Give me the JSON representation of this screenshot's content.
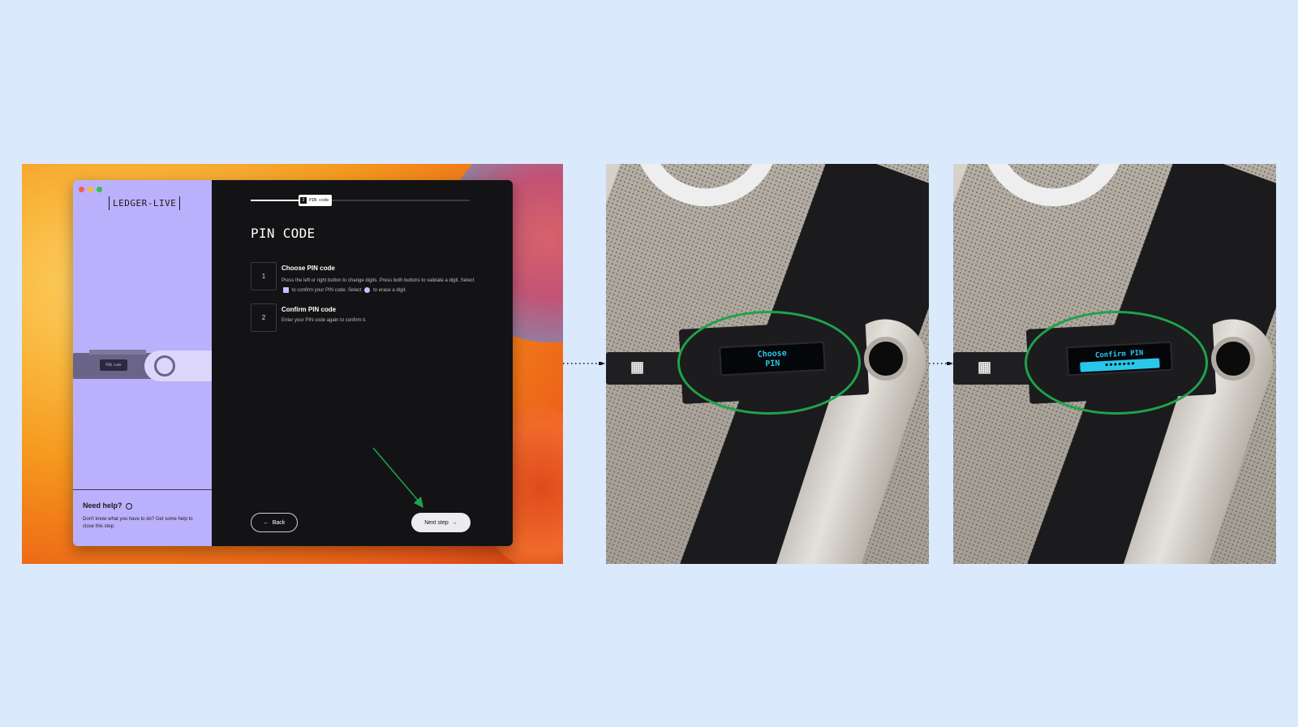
{
  "background_color": "#dbe9fd",
  "app": {
    "logo": "LEDGER-LIVE",
    "window_lights": [
      "#f05f57",
      "#f7bd2f",
      "#2fc441"
    ],
    "progress": {
      "step_number": "2",
      "step_label": "PIN code",
      "fraction": 0.22
    },
    "page_title": "PIN CODE",
    "steps": [
      {
        "number": "1",
        "title": "Choose PIN code",
        "text_part1": "Press the left or right button to change digits. Press both buttons to validate a digit. Select",
        "text_part2": "to confirm your PIN code. Select",
        "text_part3": "to erase a digit.",
        "icon_confirm": "check-icon",
        "icon_erase": "erase-icon"
      },
      {
        "number": "2",
        "title": "Confirm PIN code",
        "text": "Enter your PIN code again to confirm it."
      }
    ],
    "device_screen_label": "PIN code",
    "help": {
      "title": "Need help?",
      "text": "Don't know what you have to do? Get some help to close this step."
    },
    "buttons": {
      "back": "Back",
      "next": "Next step"
    },
    "annotation_color": "#1ea34a"
  },
  "photos": [
    {
      "screen_line1": "Choose",
      "screen_line2": "PIN",
      "annotation": "green-ellipse"
    },
    {
      "screen_line1": "Confirm PIN",
      "screen_line2": "•••••••",
      "annotation": "green-ellipse"
    }
  ]
}
